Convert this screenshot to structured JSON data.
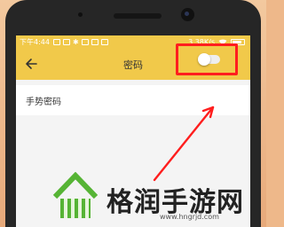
{
  "status_bar": {
    "time": "下午4:44",
    "speed": "3.38K/s",
    "icons": [
      "sim-icon",
      "bluetooth-icon",
      "notification-icon",
      "wifi-icon",
      "battery-icon"
    ]
  },
  "header": {
    "back_icon": "arrow-left-icon",
    "title": "密码"
  },
  "settings": {
    "gesture_password": {
      "label": "手势密码",
      "enabled": false
    }
  },
  "watermark": {
    "brand": "格润手游网",
    "url": "www.hngrjd.com"
  },
  "colors": {
    "accent": "#f1c94a",
    "highlight": "#ff1e1e",
    "logo_green": "#56b435"
  }
}
